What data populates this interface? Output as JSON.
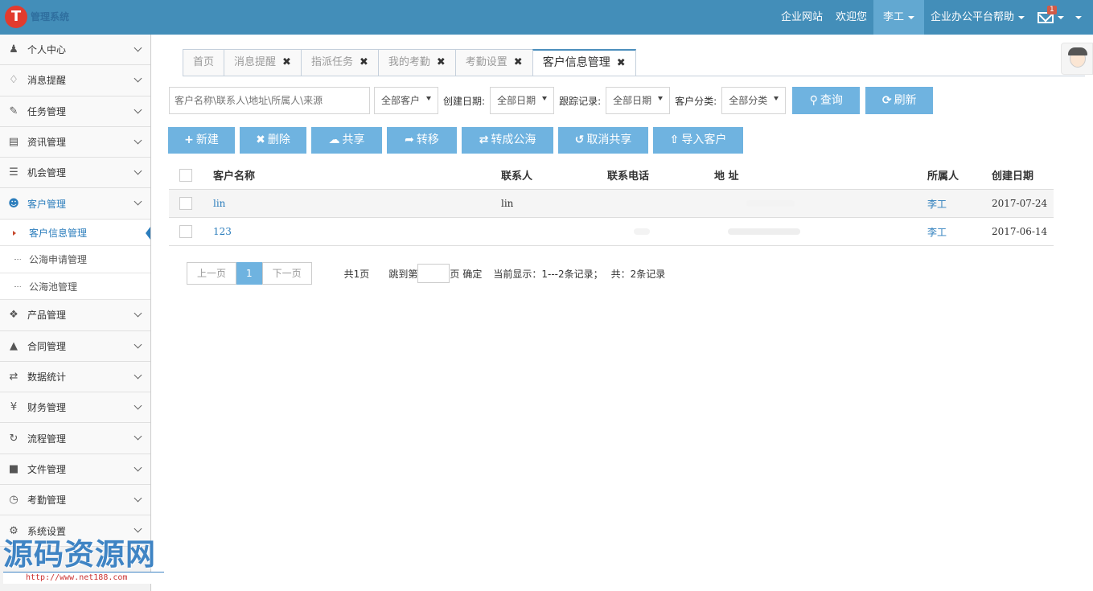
{
  "header": {
    "logo_letter": "T",
    "logo_text": "管理系统",
    "links": {
      "site": "企业网站",
      "welcome": "欢迎您",
      "user": "李工",
      "help": "企业办公平台帮助",
      "mail_badge": "1"
    }
  },
  "sidebar": {
    "items": [
      {
        "icon": "user-icon",
        "label": "个人中心"
      },
      {
        "icon": "bell-icon",
        "label": "消息提醒"
      },
      {
        "icon": "edit-icon",
        "label": "任务管理"
      },
      {
        "icon": "document-icon",
        "label": "资讯管理"
      },
      {
        "icon": "list-icon",
        "label": "机会管理"
      },
      {
        "icon": "users-icon",
        "label": "客户管理"
      },
      {
        "icon": "dropbox-icon",
        "label": "产品管理"
      },
      {
        "icon": "folder-open-icon",
        "label": "合同管理"
      },
      {
        "icon": "shuffle-icon",
        "label": "数据统计"
      },
      {
        "icon": "yen-icon",
        "label": "财务管理"
      },
      {
        "icon": "retweet-icon",
        "label": "流程管理"
      },
      {
        "icon": "file-icon",
        "label": "文件管理"
      },
      {
        "icon": "clock-icon",
        "label": "考勤管理"
      },
      {
        "icon": "gear-icon",
        "label": "系统设置"
      }
    ],
    "sub_items": [
      {
        "label": "客户信息管理"
      },
      {
        "label": "公海申请管理"
      },
      {
        "label": "公海池管理"
      }
    ]
  },
  "tabs": [
    {
      "label": "首页",
      "closable": false
    },
    {
      "label": "消息提醒",
      "closable": true
    },
    {
      "label": "指派任务",
      "closable": true
    },
    {
      "label": "我的考勤",
      "closable": true
    },
    {
      "label": "考勤设置",
      "closable": true
    },
    {
      "label": "客户信息管理",
      "closable": true
    }
  ],
  "filters": {
    "search_placeholder": "客户名称\\联系人\\地址\\所属人\\来源",
    "customer_select": "全部客户",
    "created_label": "创建日期:",
    "created_select": "全部日期",
    "track_label": "跟踪记录:",
    "track_select": "全部日期",
    "category_label": "客户分类:",
    "category_select": "全部分类",
    "query_btn": "查询",
    "refresh_btn": "刷新"
  },
  "actions": {
    "new": "新建",
    "delete": "删除",
    "share": "共享",
    "transfer": "转移",
    "to_public": "转成公海",
    "cancel_share": "取消共享",
    "import": "导入客户"
  },
  "table": {
    "headers": {
      "name": "客户名称",
      "contact": "联系人",
      "phone": "联系电话",
      "address": "地 址",
      "owner": "所属人",
      "created": "创建日期"
    },
    "rows": [
      {
        "name": "lin",
        "contact": "lin",
        "owner": "李工",
        "created": "2017-07-24"
      },
      {
        "name": "123",
        "contact": "",
        "owner": "李工",
        "created": "2017-06-14"
      }
    ]
  },
  "pager": {
    "prev": "上一页",
    "current": "1",
    "next": "下一页",
    "total_pages": "共1页",
    "jump_label": "跳到第",
    "page_unit": "页",
    "confirm": "确定",
    "showing": "当前显示：1---2条记录；",
    "total": "共：2条记录"
  },
  "watermark": {
    "text": "源码资源网",
    "url": "http://www.net188.com"
  },
  "colors": {
    "topbar": "#438eb9",
    "button": "#6fb3e0",
    "link": "#2b7dbc"
  }
}
